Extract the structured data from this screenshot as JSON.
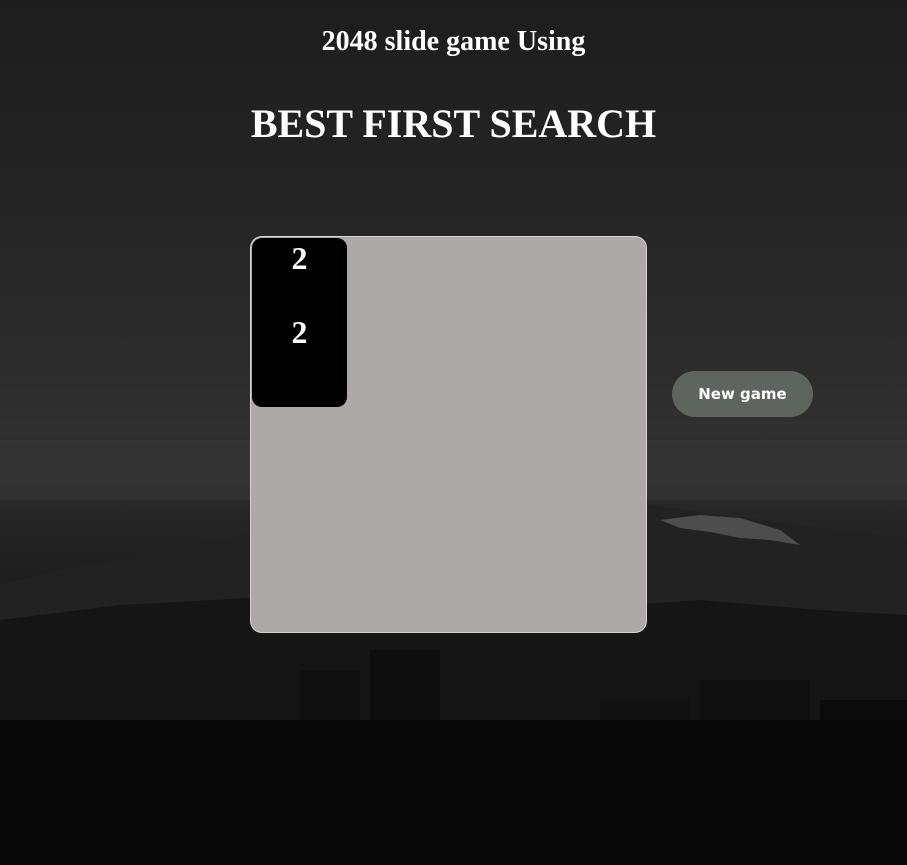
{
  "header": {
    "title_line1": "2048 slide game Using",
    "title_line2": "BEST FIRST SEARCH"
  },
  "board": {
    "size": 4,
    "tiles": [
      {
        "row": 0,
        "col": 0,
        "value": "2"
      },
      {
        "row": 1,
        "col": 0,
        "value": "2"
      }
    ]
  },
  "controls": {
    "new_game_label": "New game"
  },
  "colors": {
    "board_bg": "#ada9a9",
    "tile_bg": "#000000",
    "button_bg": "#5e655e",
    "text": "#ffffff"
  }
}
